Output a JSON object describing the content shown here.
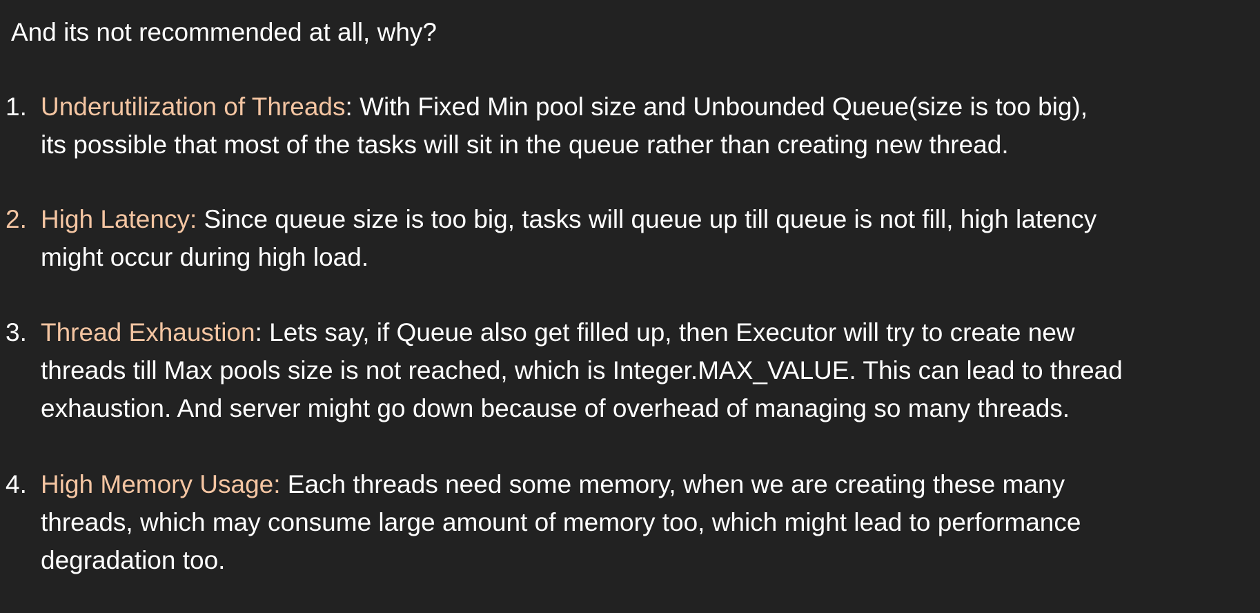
{
  "slide": {
    "intro": "And its not recommended at all, why?",
    "items": [
      {
        "number": "1.",
        "term": "Underutilization of Threads",
        "lines": [
          ": With Fixed Min pool size and Unbounded Queue(size is too big),",
          "its possible that most of the tasks will sit in the queue rather than creating new thread."
        ]
      },
      {
        "number": "2.",
        "term": "High Latency:",
        "lines": [
          " Since queue size is too big, tasks will queue up till queue is not fill, high latency",
          "might occur during high load."
        ]
      },
      {
        "number": "3.",
        "term": "Thread Exhaustion",
        "lines": [
          ": Lets say, if Queue also get filled up, then Executor will try to create new",
          "threads till Max pools size is not reached, which is Integer.MAX_VALUE. This can lead to thread",
          "exhaustion. And server might go down because of overhead of managing so many threads."
        ]
      },
      {
        "number": "4.",
        "term": "High Memory Usage:",
        "lines": [
          " Each threads need some memory, when we are creating these many",
          "threads, which may consume large amount of memory too, which might lead to performance",
          "degradation too."
        ]
      }
    ]
  }
}
